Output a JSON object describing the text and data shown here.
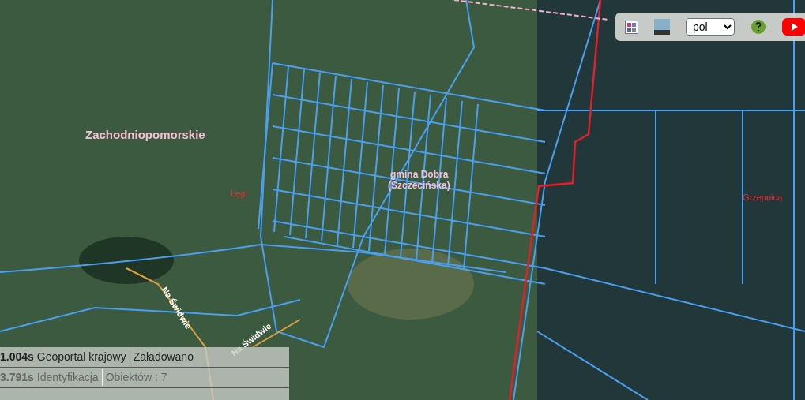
{
  "toolbar": {
    "language": {
      "value": "pol"
    }
  },
  "map": {
    "labels": [
      {
        "kind": "region",
        "text": "Zachodniopomorskie"
      },
      {
        "kind": "locality",
        "text": "Łęgi"
      },
      {
        "kind": "commune",
        "text": "gmina Dobra"
      },
      {
        "kind": "commune",
        "text": "(Szczecińska)"
      },
      {
        "kind": "locality",
        "text": "Grzepnica"
      },
      {
        "kind": "street",
        "text": "Na Świdwie"
      },
      {
        "kind": "street",
        "text": "Na Świdwie"
      }
    ]
  },
  "status_log": [
    {
      "time": "1.004s",
      "source": "Geoportal krajowy",
      "message": "Załadowano",
      "active": true
    },
    {
      "time": "3.791s",
      "source": "Identyfikacja",
      "message": "Obiektów : 7",
      "active": false
    }
  ]
}
